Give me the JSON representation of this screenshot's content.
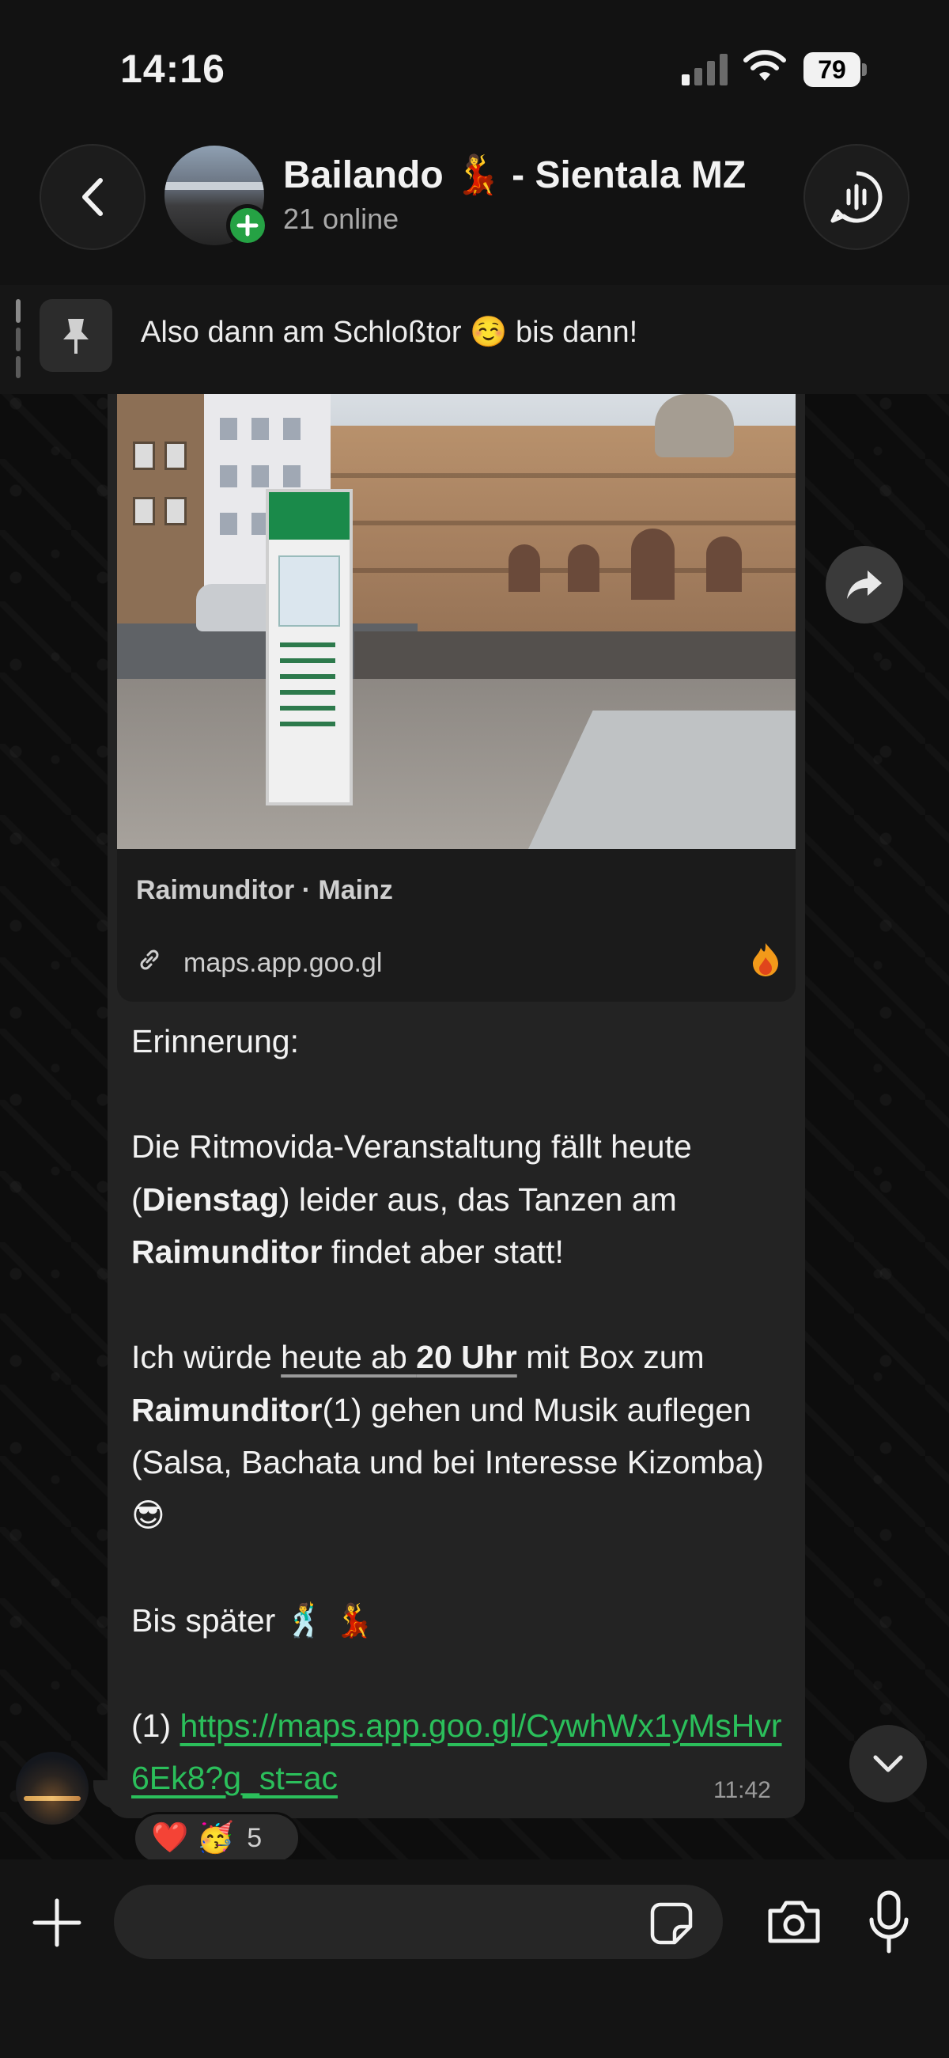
{
  "status_bar": {
    "time": "14:16",
    "battery": "79"
  },
  "header": {
    "title": "Bailando 💃 - Sientala MZ",
    "subtitle": "21 online"
  },
  "pinned": {
    "text": "Also dann am Schloßtor ☺️ bis dann!"
  },
  "message": {
    "link_preview": {
      "title": "Raimunditor · Mainz",
      "domain": "maps.app.goo.gl"
    },
    "line_1": "Erinnerung:",
    "p1_a": "Die Ritmovida-Veranstaltung fällt heute (",
    "p1_b": "Dienstag",
    "p1_c": ") leider aus, das Tanzen am ",
    "p1_d": "Raimunditor",
    "p1_e": " findet aber statt!",
    "p2_a": "Ich würde ",
    "p2_u1": "heute ab ",
    "p2_u2": "20 Uhr",
    "p2_b": " mit Box zum ",
    "p2_c": "Raimunditor",
    "p2_d": "(1) gehen und Musik auflegen (Salsa, Bachata und bei Interesse Kizomba)  😎",
    "p3": "Bis später  🕺 💃",
    "p4_prefix": "(1) ",
    "p4_url": "https://maps.app.goo.gl/CywhWx1yMsHvr6Ek8?g_st=ac",
    "time": "11:42"
  },
  "reactions": {
    "emojis": "❤️ 🥳",
    "count": "5"
  },
  "input": {
    "placeholder": ""
  },
  "colors": {
    "accent_green": "#25a244",
    "link_green": "#2bbf5b",
    "bubble": "#232323"
  }
}
